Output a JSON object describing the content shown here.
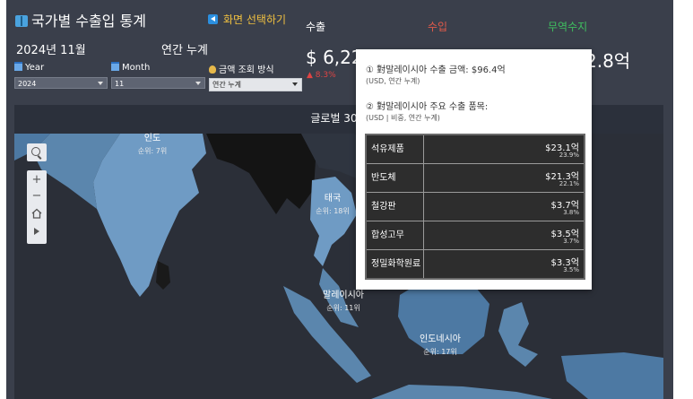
{
  "header": {
    "title": "국가별 수출입 통계",
    "screen_select": "화면 선택하기",
    "period": "2024년 11월",
    "period_type": "연간 누계"
  },
  "filters": {
    "year_label": "Year",
    "year_value": "2024",
    "month_label": "Month",
    "month_value": "11",
    "amount_label": "금액 조회 방식",
    "amount_value": "연간 누계"
  },
  "kpi": {
    "export_label": "수출",
    "import_label": "수입",
    "balance_label": "무역수지",
    "export_value": "$ 6,22",
    "export_change": "▲ 8.3%",
    "balance_value": "2.8억",
    "colors": {
      "export": "#ffffff",
      "import": "#e05a4a",
      "balance": "#3fbf5f"
    }
  },
  "map_panel": {
    "title": "글로벌 30대 ",
    "countries": [
      {
        "name": "인도",
        "rank": "순위: 7위"
      },
      {
        "name": "태국",
        "rank": "순위: 18위"
      },
      {
        "name": "말레이시아",
        "rank": "순위: 11위"
      },
      {
        "name": "인도네시아",
        "rank": "순위: 17위"
      }
    ]
  },
  "map_controls": {
    "search_icon": "search-icon",
    "zoom_in": "+",
    "zoom_out": "−",
    "home_icon": "home-icon",
    "play_icon": "play-icon"
  },
  "tooltip": {
    "line1": "① 對말레이시아 수출 금액: $96.4억",
    "line1_sub": "(USD, 연간 누계)",
    "line2": "② 對말레이시아 주요 수출 품목:",
    "line2_sub": "(USD | 비중, 연간 누계)",
    "items": [
      {
        "name": "석유제품",
        "value": "$23.1억",
        "share": "23.9%"
      },
      {
        "name": "반도체",
        "value": "$21.3억",
        "share": "22.1%"
      },
      {
        "name": "철강판",
        "value": "$3.7억",
        "share": "3.8%"
      },
      {
        "name": "합성고무",
        "value": "$3.5억",
        "share": "3.7%"
      },
      {
        "name": "정밀화학원료",
        "value": "$3.3억",
        "share": "3.5%"
      }
    ]
  }
}
